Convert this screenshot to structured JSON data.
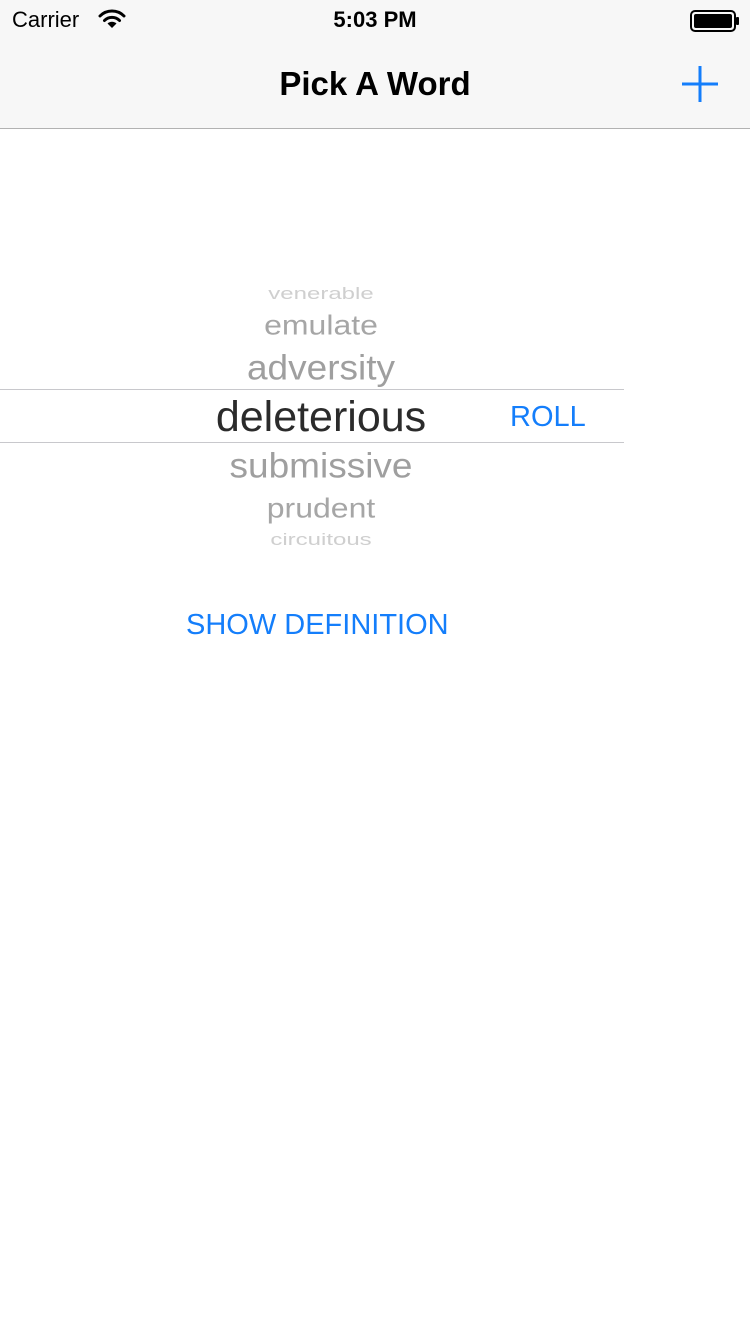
{
  "status_bar": {
    "carrier": "Carrier",
    "time": "5:03 PM",
    "wifi_icon": "wifi-icon",
    "battery_icon": "battery-full-icon"
  },
  "nav_bar": {
    "title": "Pick A Word",
    "add_icon": "plus-icon",
    "tint_color": "#147efb"
  },
  "picker": {
    "selected_index": 3,
    "words": [
      "venerable",
      "emulate",
      "adversity",
      "deleterious",
      "submissive",
      "prudent",
      "circuitous"
    ]
  },
  "actions": {
    "roll_label": "ROLL",
    "show_definition_label": "SHOW DEFINITION"
  }
}
